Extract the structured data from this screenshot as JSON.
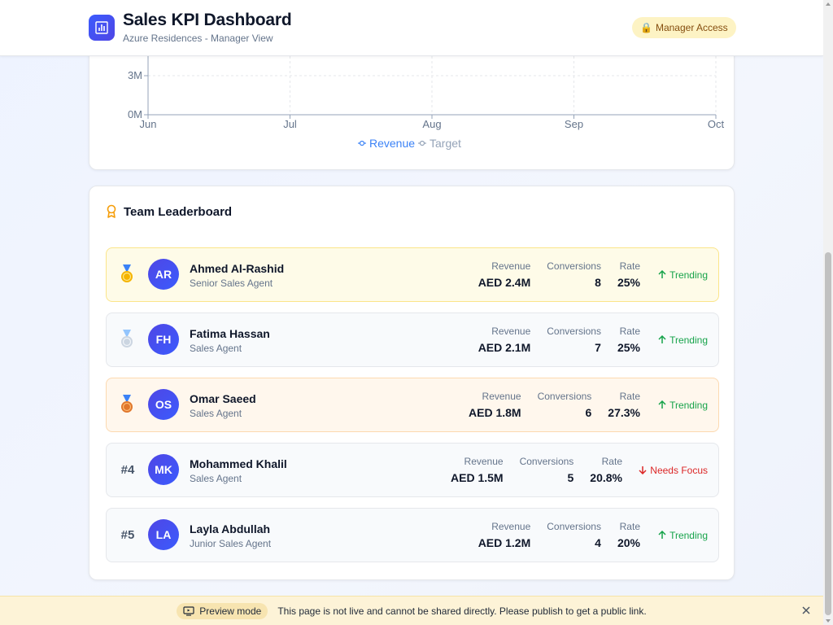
{
  "header": {
    "title": "Sales KPI Dashboard",
    "subtitle": "Azure Residences - Manager View",
    "access_badge": "Manager Access",
    "access_icon": "lock-icon"
  },
  "chart_data": {
    "type": "line",
    "x": [
      "Jun",
      "Jul",
      "Aug",
      "Sep",
      "Oct"
    ],
    "y_ticks": [
      "0M",
      "3M"
    ],
    "ylim": [
      0,
      3
    ],
    "grid": true,
    "legend_placement": "bottom",
    "series": [
      {
        "name": "Revenue",
        "color": "#3b82f6"
      },
      {
        "name": "Target",
        "color": "#94a3b8"
      }
    ]
  },
  "leaderboard": {
    "title": "Team Leaderboard",
    "labels": {
      "revenue": "Revenue",
      "conversions": "Conversions",
      "rate": "Rate"
    },
    "rows": [
      {
        "rank": "",
        "medal": "gold-medal-icon",
        "initials": "AR",
        "name": "Ahmed Al-Rashid",
        "role": "Senior Sales Agent",
        "revenue": "AED 2.4M",
        "conversions": "8",
        "rate": "25%",
        "trend": "Trending",
        "trend_dir": "up"
      },
      {
        "rank": "",
        "medal": "silver-medal-icon",
        "initials": "FH",
        "name": "Fatima Hassan",
        "role": "Sales Agent",
        "revenue": "AED 2.1M",
        "conversions": "7",
        "rate": "25%",
        "trend": "Trending",
        "trend_dir": "up"
      },
      {
        "rank": "",
        "medal": "bronze-medal-icon",
        "initials": "OS",
        "name": "Omar Saeed",
        "role": "Sales Agent",
        "revenue": "AED 1.8M",
        "conversions": "6",
        "rate": "27.3%",
        "trend": "Trending",
        "trend_dir": "up"
      },
      {
        "rank": "#4",
        "medal": "",
        "initials": "MK",
        "name": "Mohammed Khalil",
        "role": "Sales Agent",
        "revenue": "AED 1.5M",
        "conversions": "5",
        "rate": "20.8%",
        "trend": "Needs Focus",
        "trend_dir": "down"
      },
      {
        "rank": "#5",
        "medal": "",
        "initials": "LA",
        "name": "Layla Abdullah",
        "role": "Junior Sales Agent",
        "revenue": "AED 1.2M",
        "conversions": "4",
        "rate": "20%",
        "trend": "Trending",
        "trend_dir": "up"
      }
    ]
  },
  "preview": {
    "pill_label": "Preview mode",
    "message": "This page is not live and cannot be shared directly. Please publish to get a public link."
  }
}
